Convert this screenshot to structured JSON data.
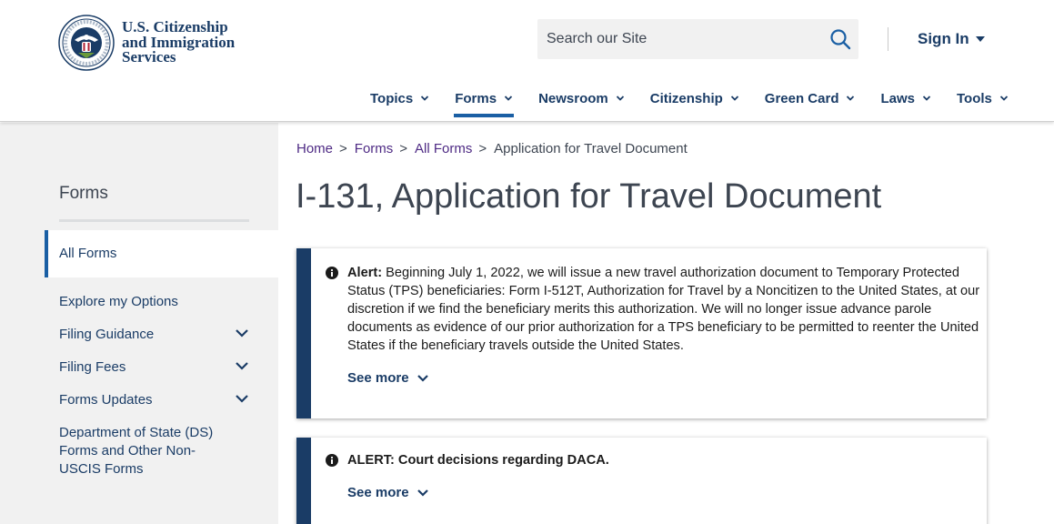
{
  "header": {
    "agency_line1": "U.S. Citizenship",
    "agency_line2": "and Immigration",
    "agency_line3": "Services",
    "search_placeholder": "Search our Site",
    "signin_label": "Sign In"
  },
  "nav": [
    {
      "label": "Topics",
      "active": false
    },
    {
      "label": "Forms",
      "active": true
    },
    {
      "label": "Newsroom",
      "active": false
    },
    {
      "label": "Citizenship",
      "active": false
    },
    {
      "label": "Green Card",
      "active": false
    },
    {
      "label": "Laws",
      "active": false
    },
    {
      "label": "Tools",
      "active": false
    }
  ],
  "sidebar": {
    "title": "Forms",
    "active_item": "All Forms",
    "items": [
      {
        "label": "Explore my Options",
        "expandable": false
      },
      {
        "label": "Filing Guidance",
        "expandable": true
      },
      {
        "label": "Filing Fees",
        "expandable": true
      },
      {
        "label": "Forms Updates",
        "expandable": true
      },
      {
        "label": "Department of State (DS) Forms and Other Non-USCIS Forms",
        "expandable": false
      }
    ]
  },
  "breadcrumb": {
    "items": [
      "Home",
      "Forms",
      "All Forms"
    ],
    "current": "Application for Travel Document",
    "separator": ">"
  },
  "page_title": "I-131, Application for Travel Document",
  "alerts": [
    {
      "label": "Alert:",
      "text": "Beginning July 1, 2022, we will issue a new travel authorization document to Temporary Protected Status (TPS) beneficiaries: Form I-512T, Authorization for Travel by a Noncitizen to the United States, at our discretion if we find the beneficiary merits this authorization. We will no longer issue advance parole documents as evidence of our prior authorization for a TPS beneficiary to be permitted to reenter the United States if the beneficiary travels outside the United States.",
      "see_more": "See more"
    },
    {
      "label": "ALERT: Court decisions regarding DACA.",
      "text": "",
      "see_more": "See more"
    }
  ],
  "colors": {
    "brand_navy": "#1a3c66",
    "link_purple": "#4e2a84",
    "active_blue": "#1a5fa4",
    "sidebar_bg": "#f1f1f1"
  },
  "icons": {
    "search": "search-icon",
    "caret": "caret-down-icon",
    "chevron": "chevron-down-icon",
    "info": "info-circle-icon",
    "seal": "dhs-seal-logo"
  }
}
